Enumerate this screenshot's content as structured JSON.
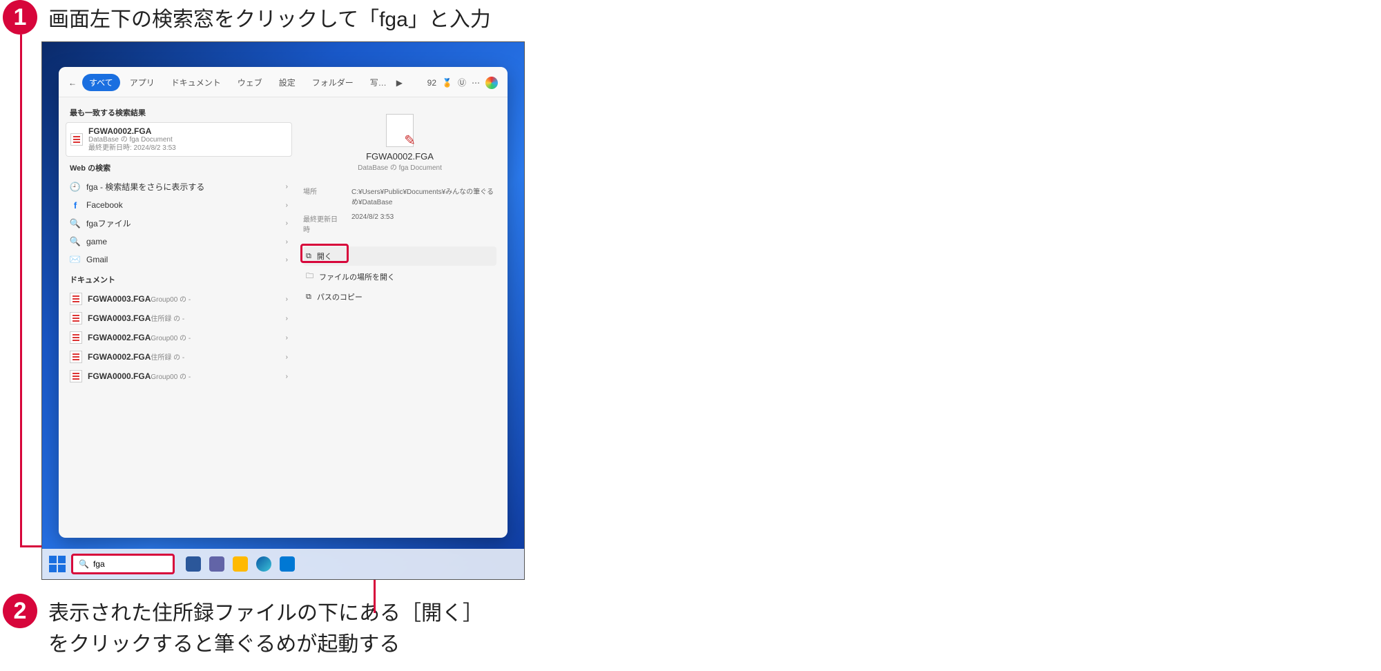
{
  "instructions": {
    "step1": "画面左下の検索窓をクリックして「fga」と入力",
    "step2_line1": "表示された住所録ファイルの下にある［開く］",
    "step2_line2": "をクリックすると筆ぐるめが起動する",
    "badge1": "1",
    "badge2": "2"
  },
  "tabs": {
    "all": "すべて",
    "apps": "アプリ",
    "documents": "ドキュメント",
    "web": "ウェブ",
    "settings": "設定",
    "folders": "フォルダー",
    "photos": "写…",
    "count": "92"
  },
  "left": {
    "best_match_label": "最も一致する検索結果",
    "best_match_title": "FGWA0002.FGA",
    "best_match_sub1": "DataBase の fga Document",
    "best_match_sub2": "最終更新日時: 2024/8/2 3:53",
    "web_label": "Web の検索",
    "web_items": {
      "fga_more": "fga - 検索結果をさらに表示する",
      "facebook": "Facebook",
      "fga_file": "fgaファイル",
      "game": "game",
      "gmail": "Gmail"
    },
    "docs_label": "ドキュメント",
    "docs": {
      "d1a": "FGWA0003.FGA",
      "d1b": "Group00 の -",
      "d2a": "FGWA0003.FGA",
      "d2b": "住所録 の -",
      "d3a": "FGWA0002.FGA",
      "d3b": "Group00 の -",
      "d4a": "FGWA0002.FGA",
      "d4b": "住所録 の -",
      "d5a": "FGWA0000.FGA",
      "d5b": "Group00 の -"
    }
  },
  "right": {
    "title": "FGWA0002.FGA",
    "sub": "DataBase の fga Document",
    "loc_k": "場所",
    "loc_v": "C:¥Users¥Public¥Documents¥みんなの筆ぐるめ¥DataBase",
    "date_k": "最終更新日時",
    "date_v": "2024/8/2 3:53",
    "actions": {
      "open": "開く",
      "open_loc": "ファイルの場所を開く",
      "copy_path": "パスのコピー"
    }
  },
  "taskbar": {
    "search_value": "fga"
  }
}
